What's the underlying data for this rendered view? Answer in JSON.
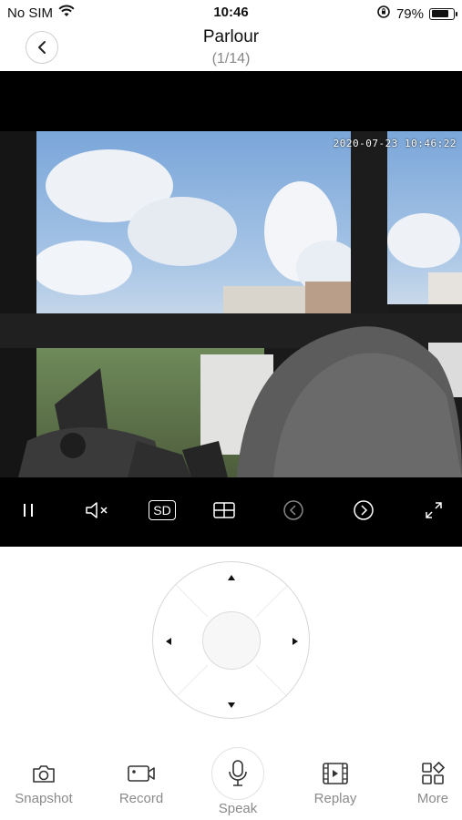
{
  "status_bar": {
    "carrier": "No SIM",
    "time": "10:46",
    "battery_percent": "79%",
    "battery_level": 0.79
  },
  "header": {
    "title": "Parlour",
    "subtitle": "(1/14)"
  },
  "video": {
    "timestamp": "2020-07-23 10:46:22",
    "quality": "SD"
  },
  "bottom_bar": {
    "snapshot": "Snapshot",
    "record": "Record",
    "speak": "Speak",
    "replay": "Replay",
    "more": "More"
  },
  "icons": [
    "wifi-icon",
    "orientation-lock-icon",
    "battery-icon",
    "back-icon",
    "pause-icon",
    "mute-icon",
    "grid-icon",
    "prev-icon",
    "next-icon",
    "fullscreen-icon",
    "camera-icon",
    "video-icon",
    "microphone-icon",
    "film-icon",
    "apps-icon"
  ]
}
